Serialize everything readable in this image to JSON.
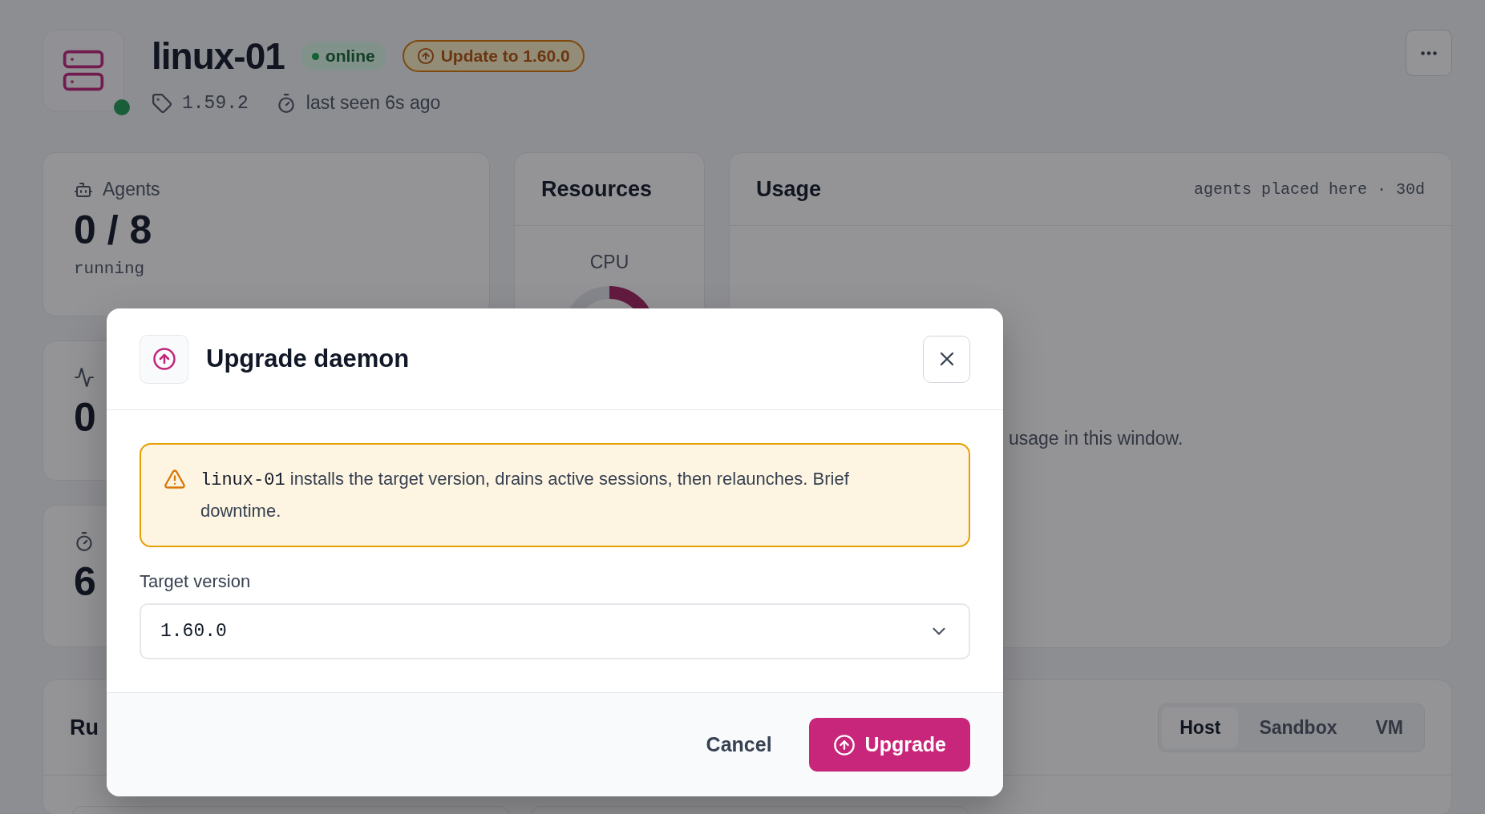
{
  "host": {
    "name": "linux-01",
    "online": true,
    "status": "online",
    "update_badge": "Update to 1.60.0",
    "version": "1.59.2",
    "last_seen": "last seen 6s ago"
  },
  "stats": [
    {
      "kind": "agents",
      "label": "Agents",
      "value": "0 / 8",
      "sub": "running"
    },
    {
      "kind": "activity",
      "value": "0"
    },
    {
      "kind": "timer",
      "value": "6"
    }
  ],
  "resources": {
    "title": "Resources",
    "cpu_label": "CPU"
  },
  "usage": {
    "title": "Usage",
    "meta": "agents placed here · 30d",
    "empty": "usage in this window."
  },
  "runtime": {
    "title": "Ru",
    "tabs": [
      {
        "label": "Host",
        "selected": true
      },
      {
        "label": "Sandbox",
        "selected": false
      },
      {
        "label": "VM",
        "selected": false
      }
    ]
  },
  "dialog": {
    "title": "Upgrade daemon",
    "warning": {
      "host": "linux-01",
      "text": "installs the target version, drains active sessions, then relaunches. Brief downtime."
    },
    "field_label": "Target version",
    "value": "1.60.0",
    "buttons": [
      {
        "kind": "secondary",
        "label": "Cancel"
      },
      {
        "kind": "primary",
        "label": "Upgrade"
      }
    ]
  }
}
